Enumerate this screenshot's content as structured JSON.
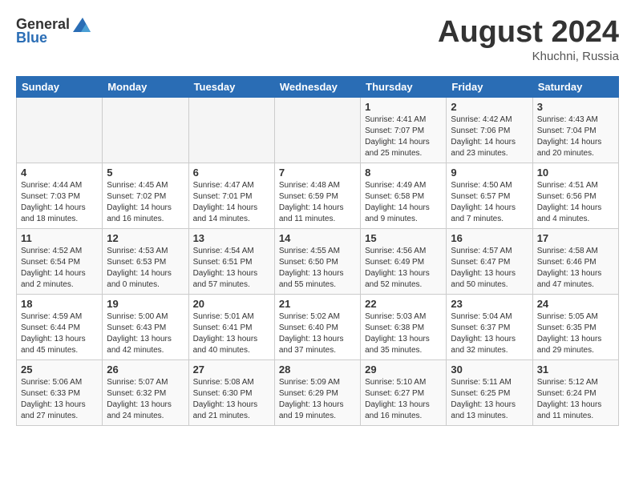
{
  "header": {
    "logo_general": "General",
    "logo_blue": "Blue",
    "month": "August 2024",
    "location": "Khuchni, Russia"
  },
  "weekdays": [
    "Sunday",
    "Monday",
    "Tuesday",
    "Wednesday",
    "Thursday",
    "Friday",
    "Saturday"
  ],
  "weeks": [
    [
      {
        "day": "",
        "info": ""
      },
      {
        "day": "",
        "info": ""
      },
      {
        "day": "",
        "info": ""
      },
      {
        "day": "",
        "info": ""
      },
      {
        "day": "1",
        "info": "Sunrise: 4:41 AM\nSunset: 7:07 PM\nDaylight: 14 hours\nand 25 minutes."
      },
      {
        "day": "2",
        "info": "Sunrise: 4:42 AM\nSunset: 7:06 PM\nDaylight: 14 hours\nand 23 minutes."
      },
      {
        "day": "3",
        "info": "Sunrise: 4:43 AM\nSunset: 7:04 PM\nDaylight: 14 hours\nand 20 minutes."
      }
    ],
    [
      {
        "day": "4",
        "info": "Sunrise: 4:44 AM\nSunset: 7:03 PM\nDaylight: 14 hours\nand 18 minutes."
      },
      {
        "day": "5",
        "info": "Sunrise: 4:45 AM\nSunset: 7:02 PM\nDaylight: 14 hours\nand 16 minutes."
      },
      {
        "day": "6",
        "info": "Sunrise: 4:47 AM\nSunset: 7:01 PM\nDaylight: 14 hours\nand 14 minutes."
      },
      {
        "day": "7",
        "info": "Sunrise: 4:48 AM\nSunset: 6:59 PM\nDaylight: 14 hours\nand 11 minutes."
      },
      {
        "day": "8",
        "info": "Sunrise: 4:49 AM\nSunset: 6:58 PM\nDaylight: 14 hours\nand 9 minutes."
      },
      {
        "day": "9",
        "info": "Sunrise: 4:50 AM\nSunset: 6:57 PM\nDaylight: 14 hours\nand 7 minutes."
      },
      {
        "day": "10",
        "info": "Sunrise: 4:51 AM\nSunset: 6:56 PM\nDaylight: 14 hours\nand 4 minutes."
      }
    ],
    [
      {
        "day": "11",
        "info": "Sunrise: 4:52 AM\nSunset: 6:54 PM\nDaylight: 14 hours\nand 2 minutes."
      },
      {
        "day": "12",
        "info": "Sunrise: 4:53 AM\nSunset: 6:53 PM\nDaylight: 14 hours\nand 0 minutes."
      },
      {
        "day": "13",
        "info": "Sunrise: 4:54 AM\nSunset: 6:51 PM\nDaylight: 13 hours\nand 57 minutes."
      },
      {
        "day": "14",
        "info": "Sunrise: 4:55 AM\nSunset: 6:50 PM\nDaylight: 13 hours\nand 55 minutes."
      },
      {
        "day": "15",
        "info": "Sunrise: 4:56 AM\nSunset: 6:49 PM\nDaylight: 13 hours\nand 52 minutes."
      },
      {
        "day": "16",
        "info": "Sunrise: 4:57 AM\nSunset: 6:47 PM\nDaylight: 13 hours\nand 50 minutes."
      },
      {
        "day": "17",
        "info": "Sunrise: 4:58 AM\nSunset: 6:46 PM\nDaylight: 13 hours\nand 47 minutes."
      }
    ],
    [
      {
        "day": "18",
        "info": "Sunrise: 4:59 AM\nSunset: 6:44 PM\nDaylight: 13 hours\nand 45 minutes."
      },
      {
        "day": "19",
        "info": "Sunrise: 5:00 AM\nSunset: 6:43 PM\nDaylight: 13 hours\nand 42 minutes."
      },
      {
        "day": "20",
        "info": "Sunrise: 5:01 AM\nSunset: 6:41 PM\nDaylight: 13 hours\nand 40 minutes."
      },
      {
        "day": "21",
        "info": "Sunrise: 5:02 AM\nSunset: 6:40 PM\nDaylight: 13 hours\nand 37 minutes."
      },
      {
        "day": "22",
        "info": "Sunrise: 5:03 AM\nSunset: 6:38 PM\nDaylight: 13 hours\nand 35 minutes."
      },
      {
        "day": "23",
        "info": "Sunrise: 5:04 AM\nSunset: 6:37 PM\nDaylight: 13 hours\nand 32 minutes."
      },
      {
        "day": "24",
        "info": "Sunrise: 5:05 AM\nSunset: 6:35 PM\nDaylight: 13 hours\nand 29 minutes."
      }
    ],
    [
      {
        "day": "25",
        "info": "Sunrise: 5:06 AM\nSunset: 6:33 PM\nDaylight: 13 hours\nand 27 minutes."
      },
      {
        "day": "26",
        "info": "Sunrise: 5:07 AM\nSunset: 6:32 PM\nDaylight: 13 hours\nand 24 minutes."
      },
      {
        "day": "27",
        "info": "Sunrise: 5:08 AM\nSunset: 6:30 PM\nDaylight: 13 hours\nand 21 minutes."
      },
      {
        "day": "28",
        "info": "Sunrise: 5:09 AM\nSunset: 6:29 PM\nDaylight: 13 hours\nand 19 minutes."
      },
      {
        "day": "29",
        "info": "Sunrise: 5:10 AM\nSunset: 6:27 PM\nDaylight: 13 hours\nand 16 minutes."
      },
      {
        "day": "30",
        "info": "Sunrise: 5:11 AM\nSunset: 6:25 PM\nDaylight: 13 hours\nand 13 minutes."
      },
      {
        "day": "31",
        "info": "Sunrise: 5:12 AM\nSunset: 6:24 PM\nDaylight: 13 hours\nand 11 minutes."
      }
    ]
  ]
}
